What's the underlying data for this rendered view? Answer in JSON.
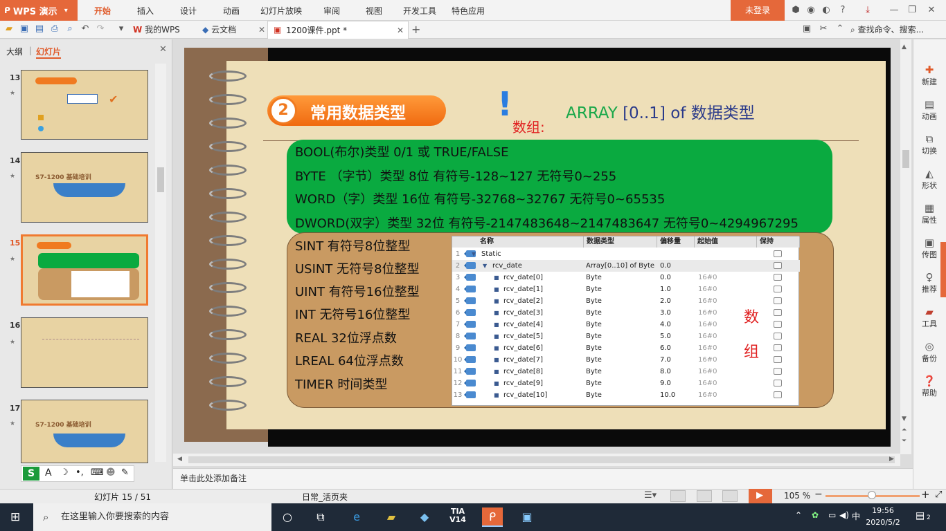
{
  "app": {
    "name": "WPS 演示"
  },
  "menu": [
    "开始",
    "插入",
    "设计",
    "动画",
    "幻灯片放映",
    "审阅",
    "视图",
    "开发工具",
    "特色应用"
  ],
  "login": "未登录",
  "tabs": {
    "mywps": "我的WPS",
    "cloud": "云文档",
    "doc": "1200课件.ppt *"
  },
  "search_placeholder": "查找命令、搜索...",
  "panel": {
    "outline": "大纲",
    "slides": "幻灯片"
  },
  "thumbnails": [
    {
      "num": "13",
      "title": ""
    },
    {
      "num": "14",
      "title": "S7-1200 基础培训"
    },
    {
      "num": "15",
      "title": ""
    },
    {
      "num": "16",
      "title": ""
    },
    {
      "num": "17",
      "title": "S7-1200 基础培训"
    }
  ],
  "slide": {
    "badge_num": "2",
    "title": "常用数据类型",
    "bang": "!",
    "array_label": "数组:",
    "array_title_green": "ARRAY",
    "array_title_rest": " [0..1] of 数据类型",
    "green_lines": [
      "BOOL(布尔)类型   0/1  或  TRUE/FALSE",
      "BYTE （字节）类型   8位 有符号-128~127 无符号0~255",
      "WORD（字）类型   16位 有符号-32768~32767  无符号0~65535",
      "DWORD(双字）类型   32位 有符号-2147483648~2147483647 无符号0~4294967295"
    ],
    "brown_lines": [
      "SINT 有符号8位整型",
      "USINT 无符号8位整型",
      "UINT 有符号16位整型",
      "INT 无符号16位整型",
      "REAL 32位浮点数",
      "LREAL 64位浮点数",
      "TIMER 时间类型"
    ],
    "red_chars": [
      "数",
      "组"
    ],
    "table": {
      "headers": [
        "名称",
        "数据类型",
        "偏移量",
        "起始值",
        "保持"
      ],
      "rows": [
        {
          "idx": "1",
          "name": "Static",
          "type": "",
          "offset": "",
          "start": ""
        },
        {
          "idx": "2",
          "name": "rcv_date",
          "type": "Array[0..10] of Byte",
          "offset": "0.0",
          "start": ""
        },
        {
          "idx": "3",
          "name": "rcv_date[0]",
          "type": "Byte",
          "offset": "0.0",
          "start": "16#0"
        },
        {
          "idx": "4",
          "name": "rcv_date[1]",
          "type": "Byte",
          "offset": "1.0",
          "start": "16#0"
        },
        {
          "idx": "5",
          "name": "rcv_date[2]",
          "type": "Byte",
          "offset": "2.0",
          "start": "16#0"
        },
        {
          "idx": "6",
          "name": "rcv_date[3]",
          "type": "Byte",
          "offset": "3.0",
          "start": "16#0"
        },
        {
          "idx": "7",
          "name": "rcv_date[4]",
          "type": "Byte",
          "offset": "4.0",
          "start": "16#0"
        },
        {
          "idx": "8",
          "name": "rcv_date[5]",
          "type": "Byte",
          "offset": "5.0",
          "start": "16#0"
        },
        {
          "idx": "9",
          "name": "rcv_date[6]",
          "type": "Byte",
          "offset": "6.0",
          "start": "16#0"
        },
        {
          "idx": "10",
          "name": "rcv_date[7]",
          "type": "Byte",
          "offset": "7.0",
          "start": "16#0"
        },
        {
          "idx": "11",
          "name": "rcv_date[8]",
          "type": "Byte",
          "offset": "8.0",
          "start": "16#0"
        },
        {
          "idx": "12",
          "name": "rcv_date[9]",
          "type": "Byte",
          "offset": "9.0",
          "start": "16#0"
        },
        {
          "idx": "13",
          "name": "rcv_date[10]",
          "type": "Byte",
          "offset": "10.0",
          "start": "16#0"
        }
      ]
    }
  },
  "sidebar": [
    {
      "icon": "new-icon",
      "label": "新建"
    },
    {
      "icon": "animation-icon",
      "label": "动画"
    },
    {
      "icon": "transition-icon",
      "label": "切换"
    },
    {
      "icon": "shape-icon",
      "label": "形状"
    },
    {
      "icon": "properties-icon",
      "label": "属性"
    },
    {
      "icon": "send-image-icon",
      "label": "传图"
    },
    {
      "icon": "recommend-icon",
      "label": "推荐"
    },
    {
      "icon": "tools-icon",
      "label": "工具"
    },
    {
      "icon": "backup-icon",
      "label": "备份"
    },
    {
      "icon": "help-icon",
      "label": "帮助"
    }
  ],
  "notes_placeholder": "单击此处添加备注",
  "status": {
    "slide_pos": "幻灯片 15 / 51",
    "theme": "日常_活页夹",
    "zoom": "105 %",
    "zoom_fraction": 0.45
  },
  "taskbar": {
    "search": "在这里输入你要搜索的内容",
    "time": "19:56",
    "date": "2020/5/2",
    "notif": "2"
  },
  "colors": {
    "accent": "#e5683a",
    "green": "#0aaa40",
    "brown": "#c99a62",
    "red": "#e02020"
  }
}
